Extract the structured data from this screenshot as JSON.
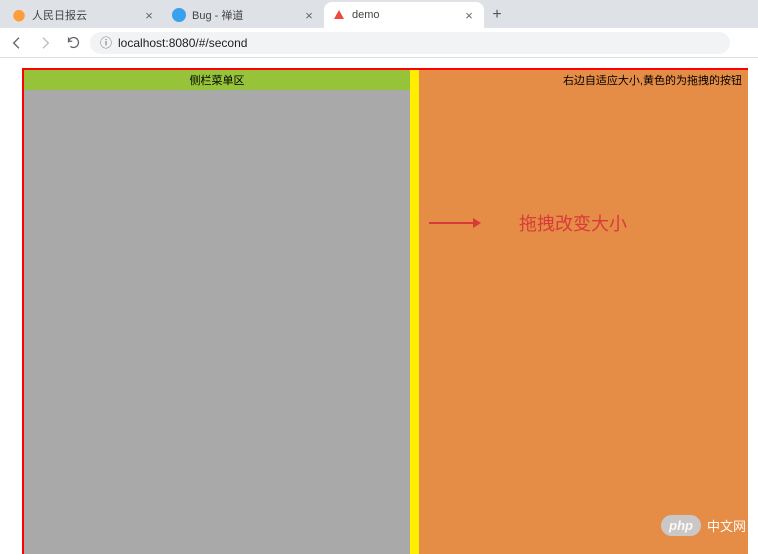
{
  "browser": {
    "tabs": [
      {
        "title": "人民日报云",
        "active": false
      },
      {
        "title": "Bug - 禅道",
        "active": false
      },
      {
        "title": "demo",
        "active": true
      }
    ],
    "url": "localhost:8080/#/second"
  },
  "layout": {
    "left_header": "侧栏菜单区",
    "right_header": "右边自适应大小,黄色的为拖拽的按钮"
  },
  "annotation": {
    "text": "拖拽改变大小"
  },
  "watermark": {
    "badge": "php",
    "text": "中文网"
  }
}
